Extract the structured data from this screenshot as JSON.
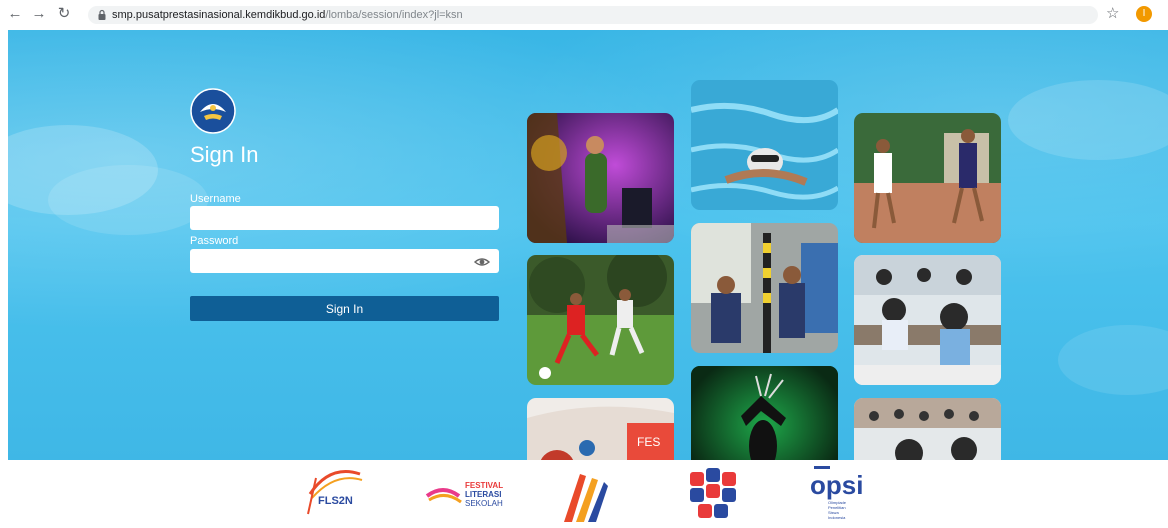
{
  "browser": {
    "url_host": "smp.pusatprestasinasional.kemdikbud.go.id",
    "url_path": "/lomba/session/index?jl=ksn",
    "profile_initial": "I"
  },
  "login": {
    "title": "Sign In",
    "username_label": "Username",
    "username_value": "",
    "password_label": "Password",
    "password_value": "",
    "submit_label": "Sign In"
  },
  "footer": {
    "logos": [
      {
        "name": "FLS2N",
        "text": "FLS2N"
      },
      {
        "name": "Festival Literasi Sekolah",
        "text": [
          "FESTIVAL",
          "LITERASI",
          "SEKOLAH"
        ]
      },
      {
        "name": "O2SN"
      },
      {
        "name": "KSN"
      },
      {
        "name": "OPSI",
        "text": "opsi",
        "subtext": [
          "Olimpiade",
          "Penelitian",
          "Siswa",
          "Indonesia"
        ]
      }
    ]
  },
  "colors": {
    "hero_bg": "#4cc3ee",
    "button": "#0f5f96",
    "profile": "#f29900"
  }
}
